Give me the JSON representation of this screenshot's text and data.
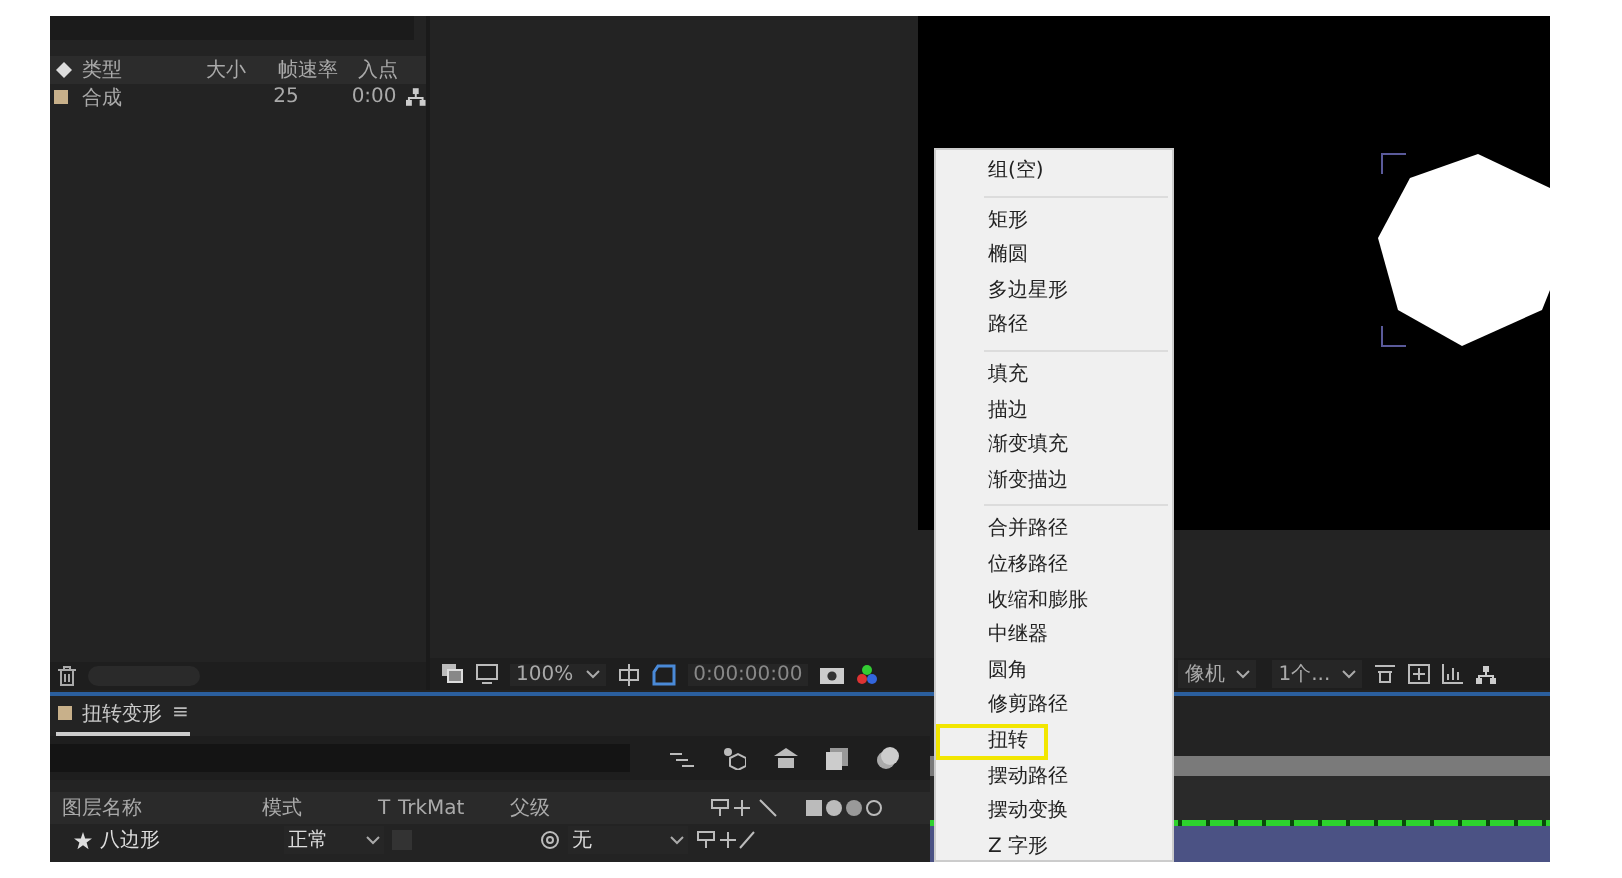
{
  "project_panel": {
    "columns": [
      "类型",
      "大小",
      "帧速率",
      "入点"
    ],
    "rows": [
      {
        "type": "合成",
        "size": "",
        "frame_rate": "25",
        "in_point": "0:00"
      }
    ]
  },
  "viewer_toolbar": {
    "zoom": "100%",
    "timecode": "0:00:00:00",
    "camera": "像机",
    "views": "1个..."
  },
  "timeline": {
    "tab": "扭转变形",
    "tab_menu": "≡",
    "columns": [
      "图层名称",
      "模式",
      "T",
      "TrkMat",
      "父级"
    ],
    "layers": [
      {
        "name": "八边形",
        "mode": "正常",
        "parent": "无"
      }
    ]
  },
  "context_menu": {
    "groups": [
      [
        {
          "label": "组(空)",
          "selected": false
        }
      ],
      [
        {
          "label": "矩形",
          "selected": false
        },
        {
          "label": "椭圆",
          "selected": false
        },
        {
          "label": "多边星形",
          "selected": false
        },
        {
          "label": "路径",
          "selected": false
        }
      ],
      [
        {
          "label": "填充",
          "selected": false
        },
        {
          "label": "描边",
          "selected": false
        },
        {
          "label": "渐变填充",
          "selected": false
        },
        {
          "label": "渐变描边",
          "selected": false
        }
      ],
      [
        {
          "label": "合并路径",
          "selected": false
        },
        {
          "label": "位移路径",
          "selected": false
        },
        {
          "label": "收缩和膨胀",
          "selected": false
        },
        {
          "label": "中继器",
          "selected": false
        },
        {
          "label": "圆角",
          "selected": false
        },
        {
          "label": "修剪路径",
          "selected": false
        },
        {
          "label": "扭转",
          "selected": true
        },
        {
          "label": "摆动路径",
          "selected": false
        },
        {
          "label": "摆动变换",
          "selected": false
        },
        {
          "label": "Z 字形",
          "selected": false
        }
      ]
    ]
  }
}
